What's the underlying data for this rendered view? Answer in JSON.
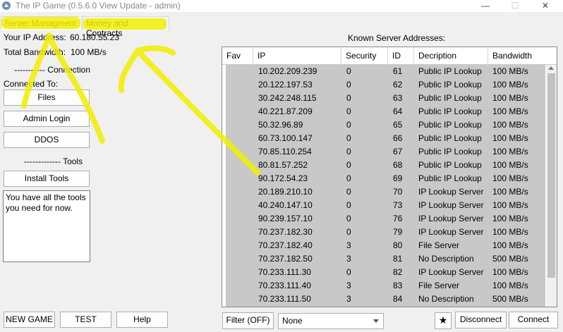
{
  "window": {
    "title": "The IP Game (0.5.6.0 View Update - admin)",
    "minimize": "—",
    "maximize": "☐",
    "close": "✕"
  },
  "tabs": [
    "Server Managment",
    "Money and Contracts"
  ],
  "left": {
    "ip_label": "Your IP Address:",
    "ip_value": "60.180.55.23",
    "bw_label": "Total Bandwidth:",
    "bw_value": "100 MB/s",
    "connection_header": "----------- Connection",
    "connected_to": "Connected To:",
    "files_button": "Files",
    "admin_login_button": "Admin Login",
    "ddos_button": "DDOS",
    "tools_header": "------------- Tools",
    "install_tools_button": "Install Tools",
    "notes_text": "You have all the tools you need for now."
  },
  "known_servers_label": "Known Server Addresses:",
  "table": {
    "columns": [
      "Fav",
      "IP",
      "Security",
      "ID",
      "Decription",
      "Bandwidth"
    ],
    "rows": [
      [
        "",
        "10.202.209.239",
        "0",
        "61",
        "Public IP Lookup",
        "100 MB/s"
      ],
      [
        "",
        "20.122.197.53",
        "0",
        "62",
        "Public IP Lookup",
        "100 MB/s"
      ],
      [
        "",
        "30.242.248.115",
        "0",
        "63",
        "Public IP Lookup",
        "100 MB/s"
      ],
      [
        "",
        "40.221.87.209",
        "0",
        "64",
        "Public IP Lookup",
        "100 MB/s"
      ],
      [
        "",
        "50.32.96.89",
        "0",
        "65",
        "Public IP Lookup",
        "100 MB/s"
      ],
      [
        "",
        "60.73.100.147",
        "0",
        "66",
        "Public IP Lookup",
        "100 MB/s"
      ],
      [
        "",
        "70.85.110.254",
        "0",
        "67",
        "Public IP Lookup",
        "100 MB/s"
      ],
      [
        "",
        "80.81.57.252",
        "0",
        "68",
        "Public IP Lookup",
        "100 MB/s"
      ],
      [
        "",
        "90.172.54.23",
        "0",
        "69",
        "Public IP Lookup",
        "100 MB/s"
      ],
      [
        "",
        "20.189.210.10",
        "0",
        "70",
        "IP Lookup Server",
        "100 MB/s"
      ],
      [
        "",
        "40.240.147.10",
        "0",
        "73",
        "IP Lookup Server",
        "100 MB/s"
      ],
      [
        "",
        "90.239.157.10",
        "0",
        "76",
        "IP Lookup Server",
        "100 MB/s"
      ],
      [
        "",
        "70.237.182.30",
        "0",
        "79",
        "IP Lookup Server",
        "100 MB/s"
      ],
      [
        "",
        "70.237.182.40",
        "3",
        "80",
        "File Server",
        "100 MB/s"
      ],
      [
        "",
        "70.237.182.50",
        "3",
        "81",
        "No Description",
        "500 MB/s"
      ],
      [
        "",
        "70.233.111.30",
        "0",
        "82",
        "IP Lookup Server",
        "100 MB/s"
      ],
      [
        "",
        "70.233.111.40",
        "3",
        "83",
        "File Server",
        "100 MB/s"
      ],
      [
        "",
        "70.233.111.50",
        "3",
        "84",
        "No Description",
        "500 MB/s"
      ]
    ]
  },
  "bottom": {
    "new_game": "NEW GAME",
    "test": "TEST",
    "help": "Help",
    "filter": "Filter (OFF)",
    "filter_select": "None",
    "favorite_star": "★",
    "disconnect": "Disconnect",
    "connect": "Connect"
  },
  "colors": {
    "highlight": "#f2ee00",
    "table_row_bg": "#c8c8c8"
  },
  "icons": {
    "app": "app-triangle-icon",
    "scroll_up": "scroll-up-arrow-icon",
    "dropdown": "chevron-down-icon"
  }
}
